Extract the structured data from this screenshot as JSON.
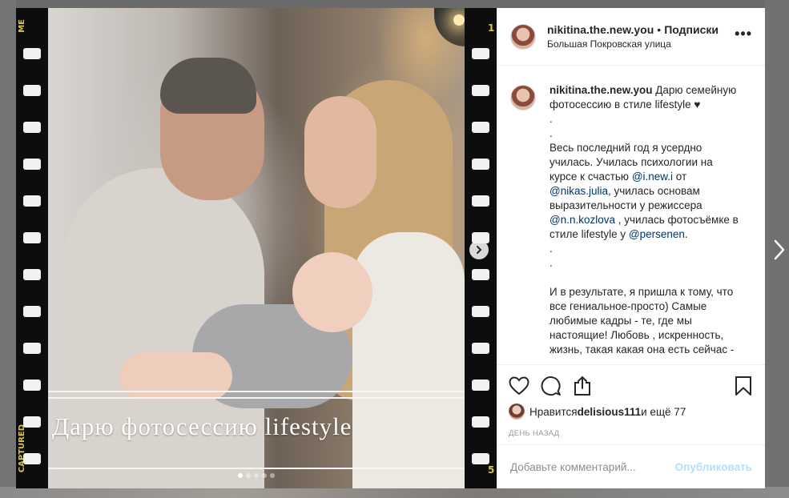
{
  "post": {
    "username": "nikitina.the.new.you",
    "separator": "•",
    "follow_label": "Подписки",
    "location": "Большая Покровская улица",
    "more_label": "•••"
  },
  "media": {
    "overlay_text": "Дарю фотосессию lifestyle",
    "film_top_left": "ME",
    "film_bottom_left": "CAPTURED",
    "film_top_right": "1",
    "film_bottom_right": "5",
    "dots_count": 5,
    "active_dot": 1
  },
  "caption": {
    "username": "nikitina.the.new.you",
    "line1": " Дарю семейную фотосессию в стиле lifestyle ♥",
    "dot1": ".",
    "dot2": ".",
    "para1_a": "Весь последний год я усердно училась. Училась психологии на курсе к счастью ",
    "mention1": "@i.new.i",
    "para1_b": " от ",
    "mention2": "@nikas.julia",
    "para1_c": ", училась основам выразительности у режиссера ",
    "mention3": "@n.n.kozlova",
    "para1_d": " , училась фотосъёмке в стиле lifestyle у ",
    "mention4": "@persenen",
    "para1_e": ".",
    "dot3": ".",
    "dot4": ".",
    "para2": "И в результате, я пришла к тому, что все гениальное-просто) Самые любимые кадры - те, где мы настоящие! Любовь , искренность, жизнь, такая какая она есть сейчас -"
  },
  "likes": {
    "prefix": "Нравится ",
    "user": "delisious111",
    "suffix": " и ещё 77"
  },
  "time_label": "День назад",
  "comment_input": {
    "placeholder": "Добавьте комментарий...",
    "value": ""
  },
  "publish_label": "Опубликовать",
  "colors": {
    "mention": "#003569",
    "publish_disabled": "#b2dffc",
    "film_text": "#d7c24a"
  }
}
